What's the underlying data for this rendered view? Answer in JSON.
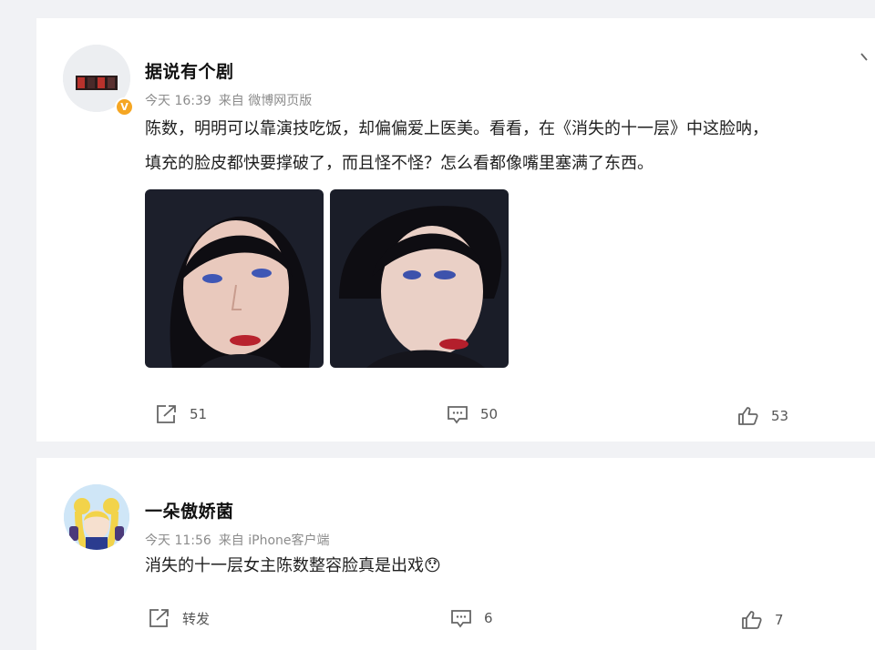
{
  "posts": [
    {
      "user": {
        "name": "据说有个剧",
        "verified_badge": "V"
      },
      "meta": {
        "time": "今天 16:39",
        "source": "来自 微博网页版"
      },
      "text_lines": [
        "陈数，明明可以靠演技吃饭，却偏偏爱上医美。看看，在《消失的十一层》中这脸呐，",
        "填充的脸皮都快要撑破了，而且怪不怪？怎么看都像嘴里塞满了东西。"
      ],
      "images": [
        "drama-still-1",
        "drama-still-2"
      ],
      "actions": {
        "repost": "51",
        "comment": "50",
        "like": "53"
      }
    },
    {
      "user": {
        "name": "一朵傲娇菌"
      },
      "meta": {
        "time": "今天 11:56",
        "source": "来自 iPhone客户端"
      },
      "text_lines": [
        "消失的十一层女主陈数整容脸真是出戏"
      ],
      "emoji": "😯",
      "actions": {
        "repost": "转发",
        "comment": "6",
        "like": "7"
      }
    }
  ],
  "colors": {
    "background": "#f1f2f5",
    "card": "#ffffff",
    "meta_gray": "#8c8c8c",
    "verified": "#f5a623"
  }
}
